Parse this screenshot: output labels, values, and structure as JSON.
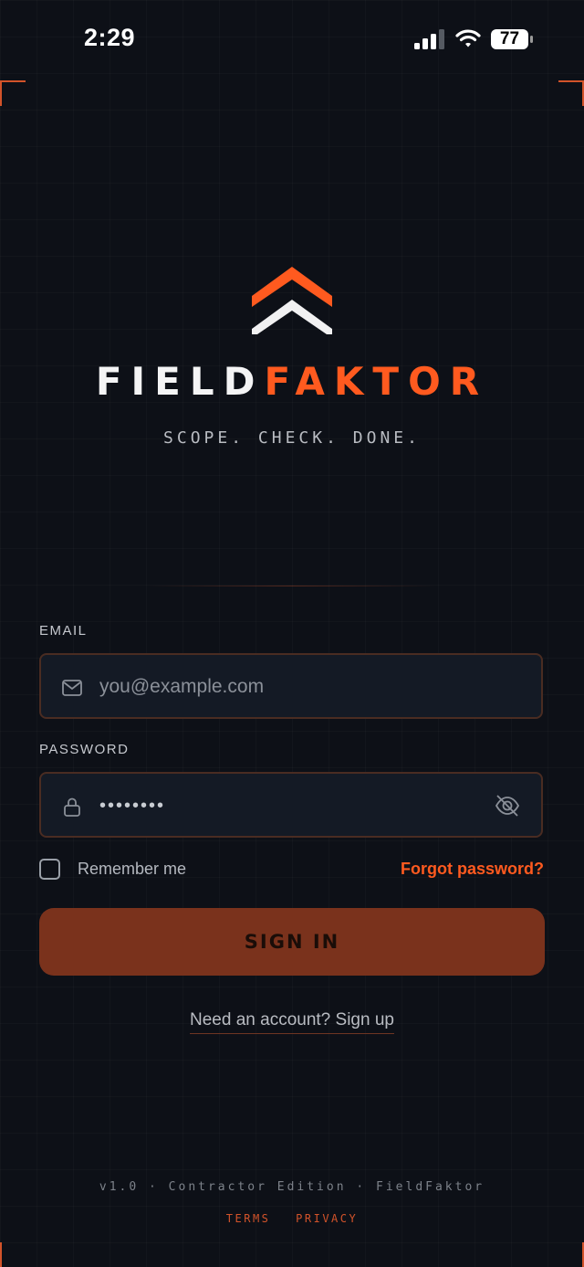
{
  "status_bar": {
    "time": "2:29",
    "battery_level": "77",
    "signal_bars_active": 3,
    "signal_bars_total": 4
  },
  "brand": {
    "name_part1": "FIELD",
    "name_part2": "FAKTOR",
    "tagline": "SCOPE. CHECK. DONE.",
    "accent_color": "#ff5a1f",
    "logo_icon": "double-chevron-up-icon"
  },
  "login_form": {
    "email_label": "EMAIL",
    "email_placeholder": "you@example.com",
    "email_value": "",
    "email_icon": "mail-icon",
    "password_label": "PASSWORD",
    "password_value": "••••••••",
    "password_icon": "lock-icon",
    "password_toggle_icon": "eye-off-icon",
    "remember_me_label": "Remember me",
    "remember_me_checked": false,
    "forgot_password_label": "Forgot password?",
    "sign_in_label": "SIGN IN",
    "sign_up_prompt": "Need an account? Sign up"
  },
  "footer": {
    "version_line": "v1.0 · Contractor Edition · FieldFaktor",
    "terms_label": "TERMS",
    "privacy_label": "PRIVACY"
  }
}
